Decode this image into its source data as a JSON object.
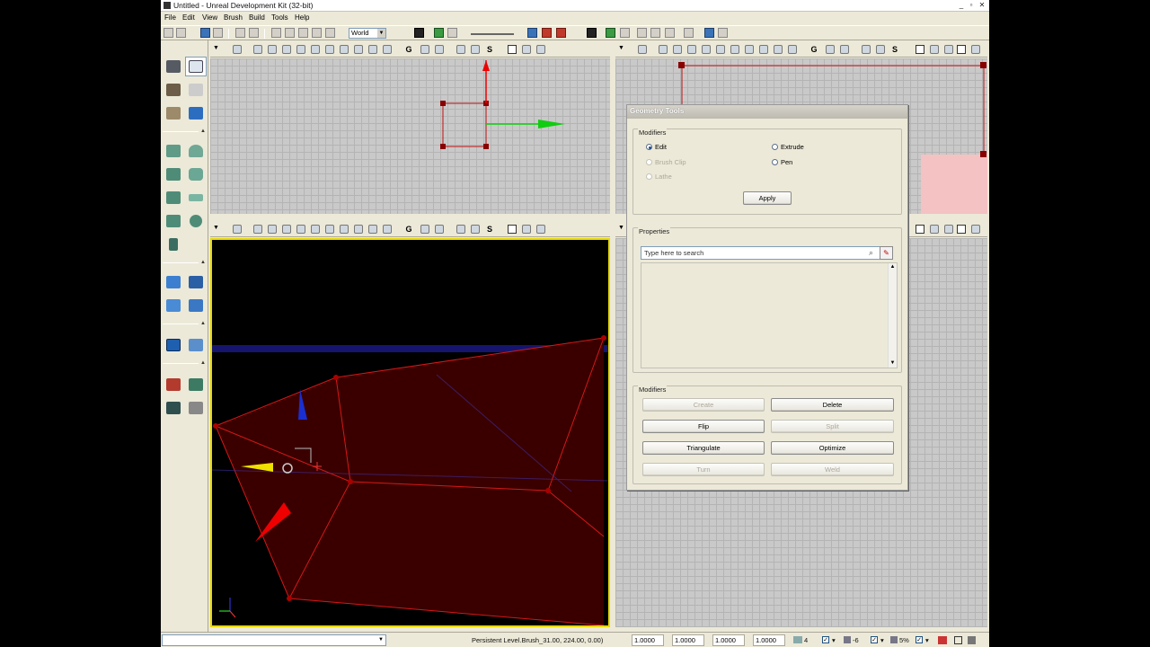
{
  "window": {
    "title": "Untitled - Unreal Development Kit (32-bit)",
    "minimize": "_",
    "maximize": "▫",
    "close": "✕"
  },
  "menu": [
    "File",
    "Edit",
    "View",
    "Brush",
    "Build",
    "Tools",
    "Help"
  ],
  "toolbar": {
    "coordinate_system": "World"
  },
  "viewports": {
    "top": {
      "mode": "wireframe-grid",
      "active": false
    },
    "side": {
      "mode": "wireframe-grid",
      "active": false
    },
    "perspective": {
      "mode": "lit",
      "active": true
    },
    "front": {
      "mode": "wireframe-grid",
      "active": false
    }
  },
  "geometry_tools": {
    "title": "Geometry Tools",
    "modifiers_group": {
      "label": "Modifiers",
      "options": [
        {
          "label": "Edit",
          "selected": true,
          "enabled": true
        },
        {
          "label": "Extrude",
          "selected": false,
          "enabled": true
        },
        {
          "label": "Brush Clip",
          "selected": false,
          "enabled": false
        },
        {
          "label": "Pen",
          "selected": false,
          "enabled": true
        },
        {
          "label": "Lathe",
          "selected": false,
          "enabled": false
        }
      ],
      "apply_label": "Apply"
    },
    "properties": {
      "label": "Properties",
      "search_placeholder": "Type here to search"
    },
    "actions_group": {
      "label": "Modifiers",
      "buttons": [
        {
          "label": "Create",
          "enabled": false
        },
        {
          "label": "Delete",
          "enabled": true
        },
        {
          "label": "Flip",
          "enabled": true
        },
        {
          "label": "Split",
          "enabled": false
        },
        {
          "label": "Triangulate",
          "enabled": true
        },
        {
          "label": "Optimize",
          "enabled": true
        },
        {
          "label": "Turn",
          "enabled": false
        },
        {
          "label": "Weld",
          "enabled": false
        }
      ]
    }
  },
  "statusbar": {
    "location": "Persistent Level.Brush_31.00, 224.00, 0.00)",
    "drag_grid": [
      "1.0000",
      "1.0000",
      "1.0000",
      "1.0000"
    ],
    "grid_size": "4",
    "rotation_snap": "-6",
    "scale_snap": "5%"
  },
  "colors": {
    "accent_selection": "#e8d900",
    "brush_red": "#c01010",
    "builder_brush_fill": "#3a0000"
  }
}
